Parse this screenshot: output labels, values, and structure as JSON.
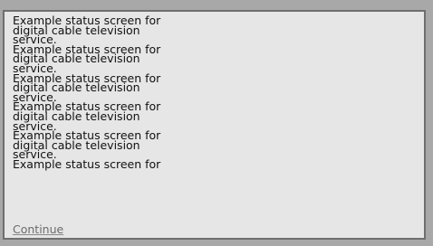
{
  "status_screen": {
    "lines": [
      "Example status screen for",
      "digital cable television",
      "service.",
      "Example status screen for",
      "digital cable television",
      "service.",
      "Example status screen for",
      "digital cable television",
      "service.",
      "Example status screen for",
      "digital cable television",
      "service.",
      "Example status screen for",
      "digital cable television",
      "service.",
      "Example status screen for"
    ],
    "continue_label": "Continue"
  }
}
